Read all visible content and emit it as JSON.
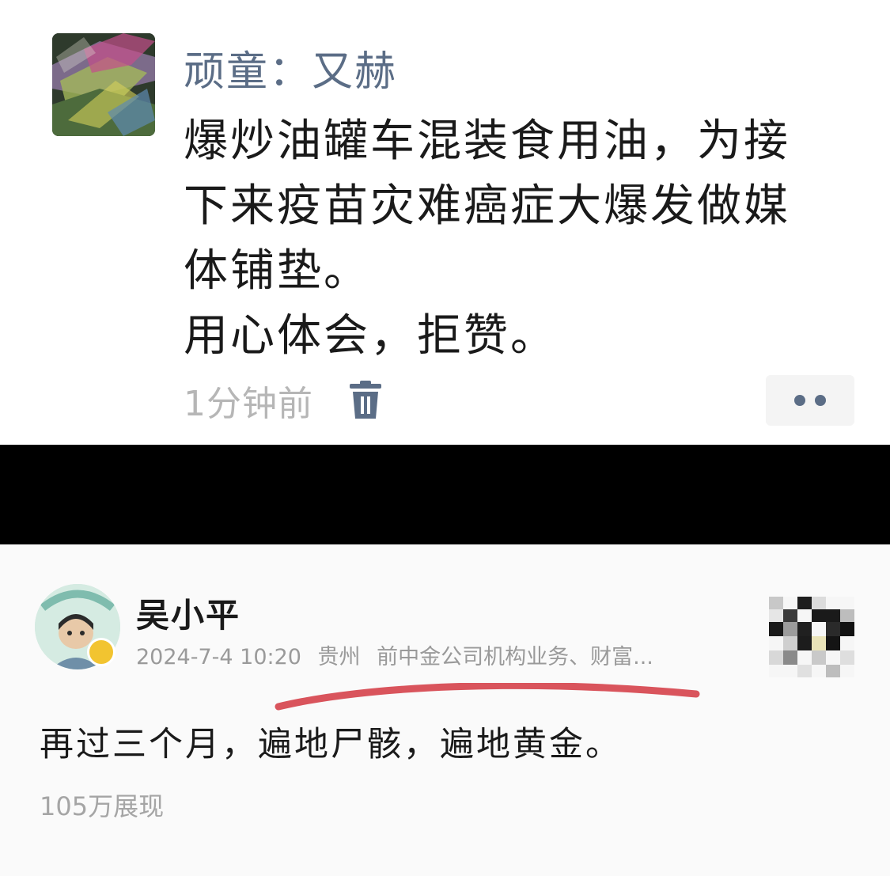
{
  "top_post": {
    "author": "顽童：又赫",
    "content_lines": [
      "爆炒油罐车混装食用油，为接",
      "下来疫苗灾难癌症大爆发做媒",
      "体铺垫。",
      "用心体会，拒赞。"
    ],
    "time": "1分钟前",
    "delete_icon": "trash-icon",
    "more_icon": "more-dots-icon"
  },
  "bottom_post": {
    "author": "吴小平",
    "date": "2024-7-4 10:20",
    "location": "贵州",
    "bio": "前中金公司机构业务、财富...",
    "content": "再过三个月，遍地尸骸，遍地黄金。",
    "views": "105万展现",
    "annotation_color": "#d9545c"
  },
  "colors": {
    "name_blue": "#5b6d86",
    "separator": "#000000"
  }
}
